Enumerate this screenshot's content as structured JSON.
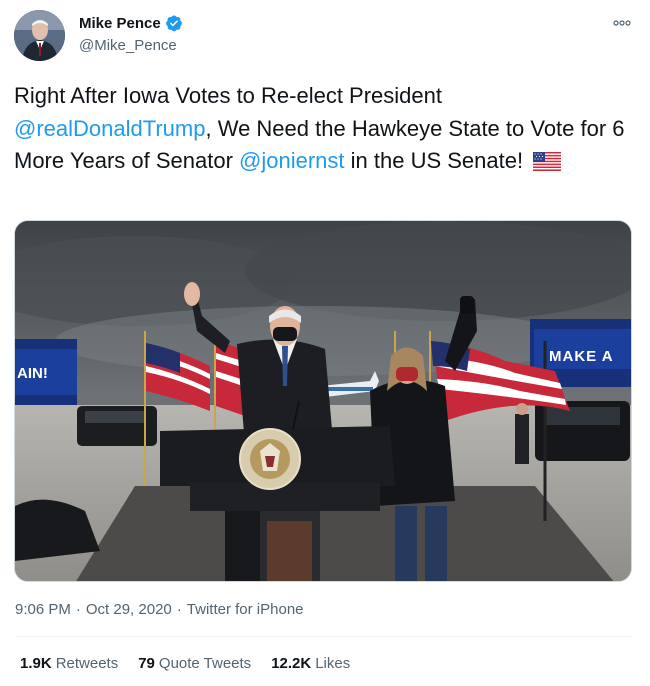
{
  "author": {
    "name": "Mike Pence",
    "handle": "@Mike_Pence",
    "verified": true
  },
  "icons": {
    "verified": "verified-badge-icon",
    "more": "more-options-icon",
    "flag": "us-flag-emoji"
  },
  "tweet": {
    "text_1": "Right After Iowa Votes to Re-elect President ",
    "mention_1": "@realDonaldTrump",
    "text_2": ", We Need the Hawkeye State to Vote for 6 More Years of Senator ",
    "mention_2": "@joniernst",
    "text_3": " in the US Senate! "
  },
  "photo": {
    "left_sign": "AIN!",
    "right_sign": "MAKE A",
    "seal_text": "SEAL OF THE VICE PRESIDENT OF THE UNITED STATES"
  },
  "meta": {
    "time": "9:06 PM",
    "sep1": "·",
    "date": "Oct 29, 2020",
    "sep2": "·",
    "source": "Twitter for iPhone"
  },
  "stats": {
    "retweets_count": "1.9K",
    "retweets_label": "Retweets",
    "quotes_count": "79",
    "quotes_label": "Quote Tweets",
    "likes_count": "12.2K",
    "likes_label": "Likes"
  },
  "colors": {
    "link": "#1d9bf0",
    "text": "#0f1419",
    "secondary": "#536471"
  }
}
